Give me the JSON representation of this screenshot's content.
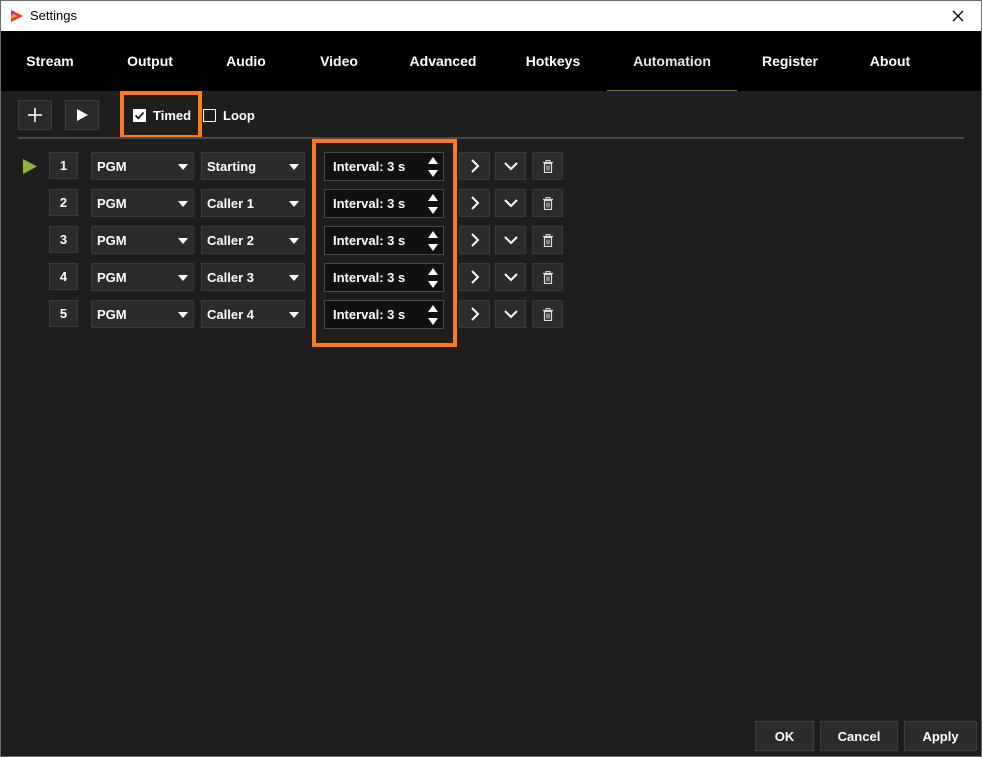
{
  "window": {
    "title": "Settings"
  },
  "tabs": [
    {
      "label": "Stream",
      "active": false
    },
    {
      "label": "Output",
      "active": false
    },
    {
      "label": "Audio",
      "active": false
    },
    {
      "label": "Video",
      "active": false
    },
    {
      "label": "Advanced",
      "active": false
    },
    {
      "label": "Hotkeys",
      "active": false
    },
    {
      "label": "Automation",
      "active": true
    },
    {
      "label": "Register",
      "active": false
    },
    {
      "label": "About",
      "active": false
    }
  ],
  "toolbar": {
    "add_icon": "plus-icon",
    "play_icon": "play-icon",
    "timed": {
      "label": "Timed",
      "checked": true
    },
    "loop": {
      "label": "Loop",
      "checked": false
    }
  },
  "rows": [
    {
      "number": "1",
      "source": "PGM",
      "scene": "Starting",
      "interval": "Interval: 3 s",
      "active": true
    },
    {
      "number": "2",
      "source": "PGM",
      "scene": "Caller 1",
      "interval": "Interval: 3 s",
      "active": false
    },
    {
      "number": "3",
      "source": "PGM",
      "scene": "Caller 2",
      "interval": "Interval: 3 s",
      "active": false
    },
    {
      "number": "4",
      "source": "PGM",
      "scene": "Caller 3",
      "interval": "Interval: 3 s",
      "active": false
    },
    {
      "number": "5",
      "source": "PGM",
      "scene": "Caller 4",
      "interval": "Interval: 3 s",
      "active": false
    }
  ],
  "footer": {
    "ok": "OK",
    "cancel": "Cancel",
    "apply": "Apply"
  },
  "colors": {
    "highlight": "#ff7a1a",
    "active_indicator": "#8fb43a",
    "background": "#1e1e1e",
    "tabbar": "#000000"
  }
}
